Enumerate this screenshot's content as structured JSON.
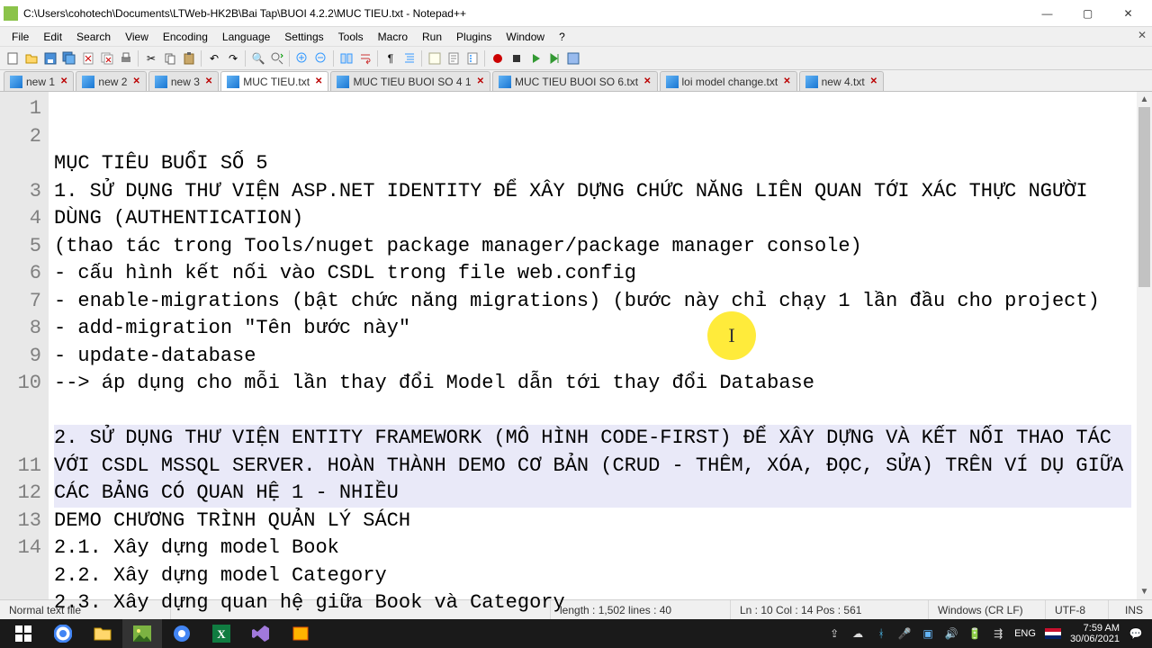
{
  "window": {
    "title": "C:\\Users\\cohotech\\Documents\\LTWeb-HK2B\\Bai Tap\\BUOI 4.2.2\\MUC TIEU.txt - Notepad++"
  },
  "menu": [
    "File",
    "Edit",
    "Search",
    "View",
    "Encoding",
    "Language",
    "Settings",
    "Tools",
    "Macro",
    "Run",
    "Plugins",
    "Window",
    "?"
  ],
  "tabs": [
    {
      "label": "new 1",
      "active": false
    },
    {
      "label": "new 2",
      "active": false
    },
    {
      "label": "new 3",
      "active": false
    },
    {
      "label": "MUC TIEU.txt",
      "active": true
    },
    {
      "label": "MUC TIEU BUOI SO 4 1",
      "active": false
    },
    {
      "label": "MUC TIEU BUOI SO 6.txt",
      "active": false
    },
    {
      "label": "loi model change.txt",
      "active": false
    },
    {
      "label": "new 4.txt",
      "active": false
    }
  ],
  "editor": {
    "lines": [
      {
        "n": "1",
        "t": "MỤC TIÊU BUỔI SỐ 5"
      },
      {
        "n": "2",
        "t": "1. SỬ DỤNG THƯ VIỆN ASP.NET IDENTITY ĐỂ XÂY DỰNG CHỨC NĂNG LIÊN QUAN TỚI XÁC THỰC NGƯỜI DÙNG (AUTHENTICATION)"
      },
      {
        "n": "3",
        "t": "(thao tác trong Tools/nuget package manager/package manager console)"
      },
      {
        "n": "4",
        "t": "- cấu hình kết nối vào CSDL trong file web.config"
      },
      {
        "n": "5",
        "t": "- enable-migrations (bật chức năng migrations) (bước này chỉ chạy 1 lần đầu cho project)"
      },
      {
        "n": "6",
        "t": "- add-migration \"Tên bước này\""
      },
      {
        "n": "7",
        "t": "- update-database"
      },
      {
        "n": "8",
        "t": "--> áp dụng cho mỗi lần thay đổi Model dẫn tới thay đổi Database"
      },
      {
        "n": "9",
        "t": ""
      },
      {
        "n": "10",
        "t": "2. SỬ DỤNG THƯ VIỆN ENTITY FRAMEWORK (MÔ HÌNH CODE-FIRST) ĐỂ XÂY DỰNG VÀ KẾT NỐI THAO TÁC VỚI CSDL MSSQL SERVER. HOÀN THÀNH DEMO CƠ BẢN (CRUD - THÊM, XÓA, ĐỌC, SỬA) TRÊN VÍ DỤ GIỮA CÁC BẢNG CÓ QUAN HỆ 1 - NHIỀU",
        "hl": true
      },
      {
        "n": "11",
        "t": "DEMO CHƯƠNG TRÌNH QUẢN LÝ SÁCH"
      },
      {
        "n": "12",
        "t": "2.1. Xây dựng model Book"
      },
      {
        "n": "13",
        "t": "2.2. Xây dựng model Category"
      },
      {
        "n": "14",
        "t": "2.3. Xây dựng quan hệ giữa Book và Category"
      }
    ]
  },
  "status": {
    "filetype": "Normal text file",
    "length": "length : 1,502    lines : 40",
    "pos": "Ln : 10    Col : 14    Pos : 561",
    "eol": "Windows (CR LF)",
    "enc": "UTF-8",
    "ovr": "INS"
  },
  "tray": {
    "lang": "ENG",
    "time": "7:59 AM",
    "date": "30/06/2021"
  }
}
